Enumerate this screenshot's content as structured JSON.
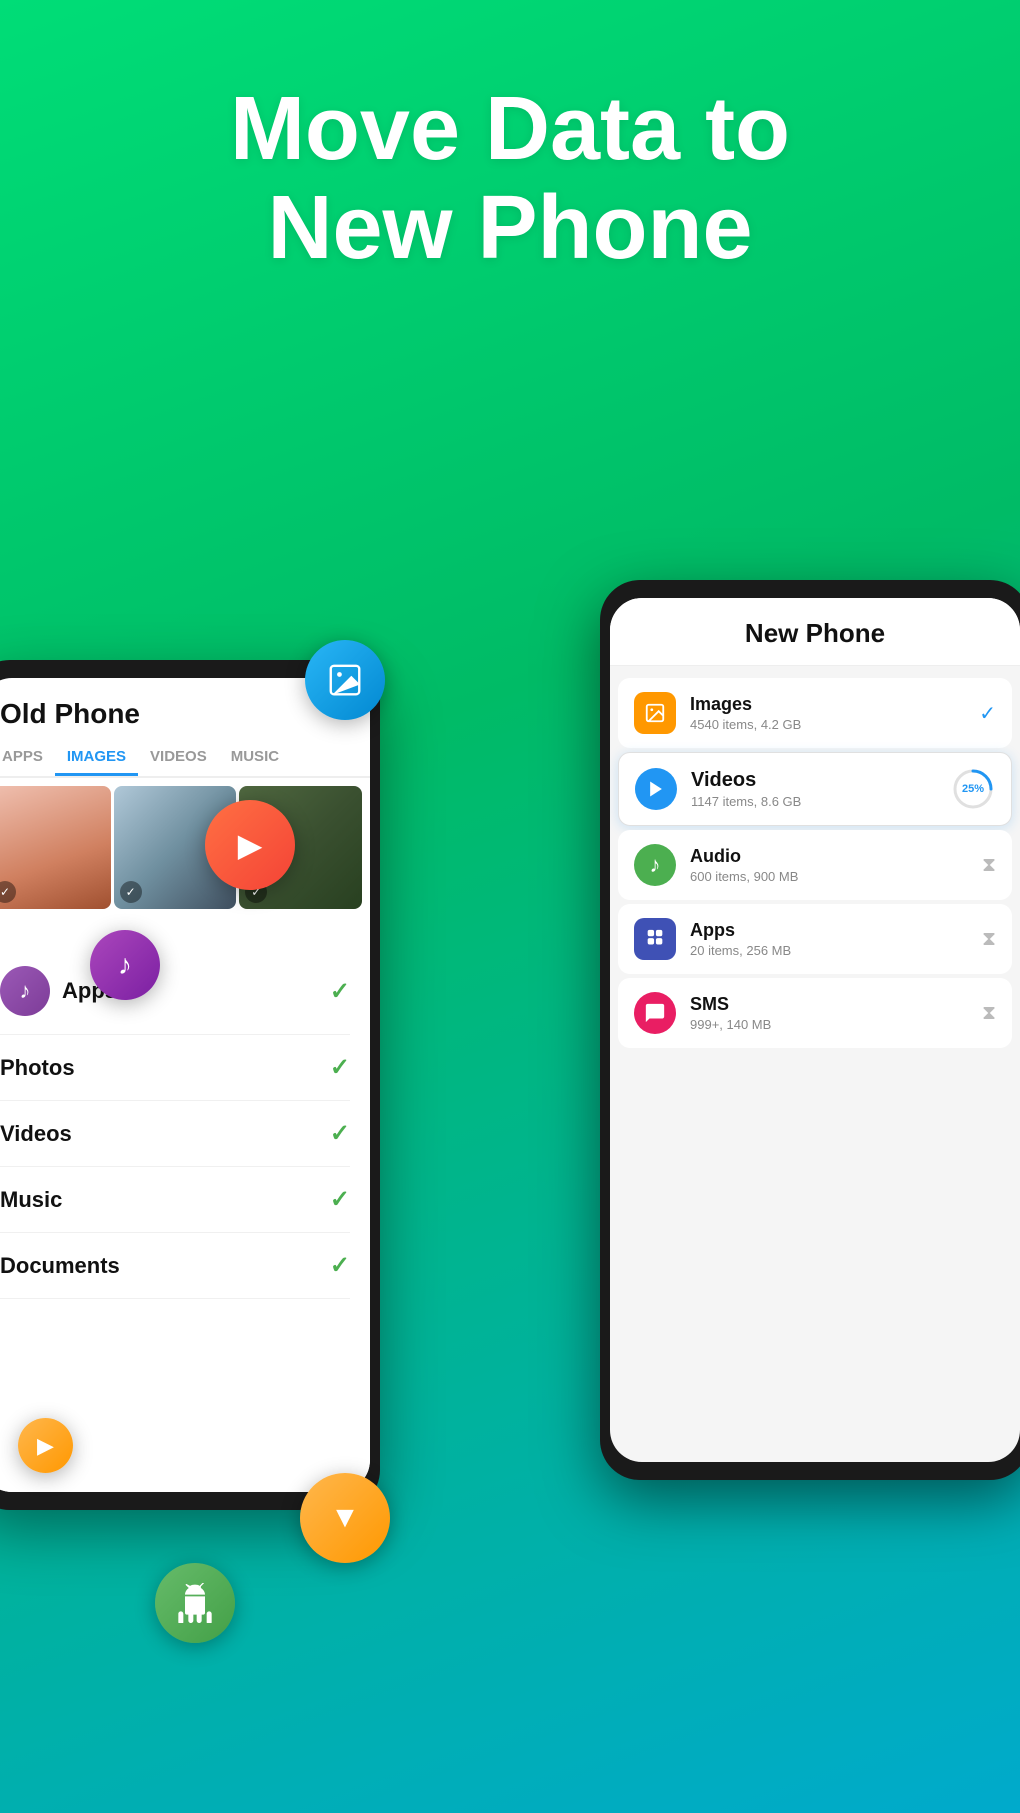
{
  "hero": {
    "title_line1": "Move Data to",
    "title_line2": "New Phone"
  },
  "old_phone": {
    "title": "Old Phone",
    "tabs": [
      "APPS",
      "IMAGES",
      "VIDEOS",
      "MUSIC"
    ],
    "active_tab": "IMAGES",
    "list": [
      {
        "label": "Apps",
        "checked": true
      },
      {
        "label": "Photos",
        "checked": true
      },
      {
        "label": "Videos",
        "checked": true
      },
      {
        "label": "Music",
        "checked": true
      },
      {
        "label": "Documents",
        "checked": true
      }
    ]
  },
  "new_phone": {
    "title": "New Phone",
    "items": [
      {
        "name": "Images",
        "sub": "4540 items, 4.2 GB",
        "status": "done"
      },
      {
        "name": "Videos",
        "sub": "1147 items, 8.6 GB",
        "status": "progress",
        "progress": "25%"
      },
      {
        "name": "Audio",
        "sub": "600 items, 900 MB",
        "status": "waiting"
      },
      {
        "name": "Apps",
        "sub": "20 items, 256 MB",
        "status": "waiting"
      },
      {
        "name": "SMS",
        "sub": "999+, 140 MB",
        "status": "waiting"
      }
    ]
  },
  "icons": {
    "image": "🖼",
    "play": "▶",
    "arrow_down": "▼",
    "android": "🤖",
    "music": "♪",
    "check": "✓",
    "hourglass": "⧖"
  }
}
